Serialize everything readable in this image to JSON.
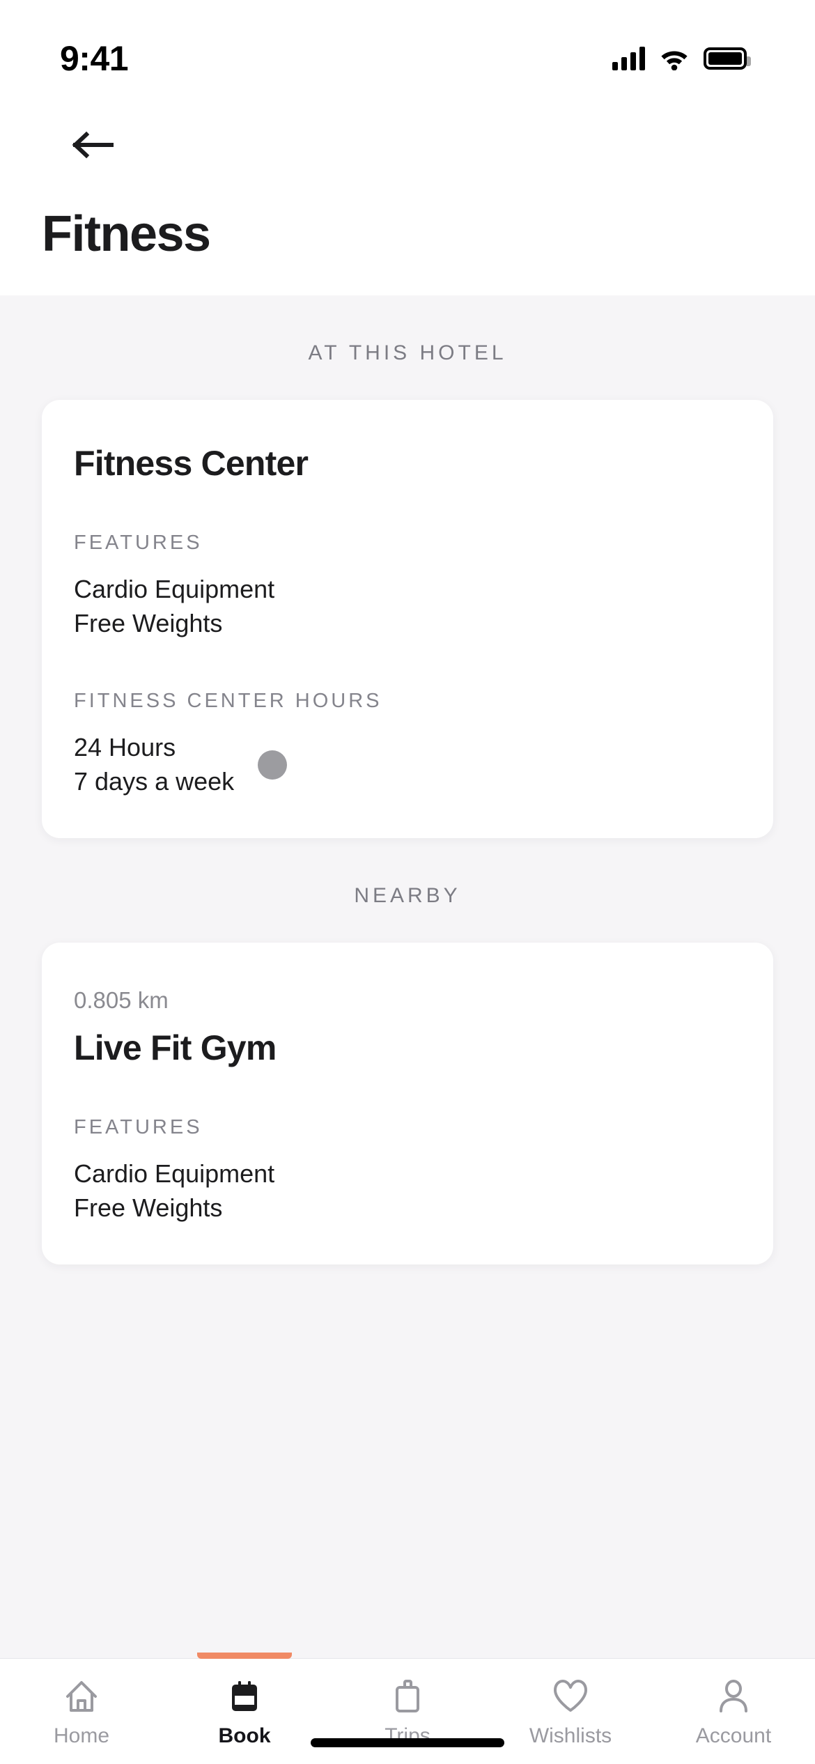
{
  "status_bar": {
    "time": "9:41",
    "signal_icon": "cellular-signal-icon",
    "wifi_icon": "wifi-icon",
    "battery_icon": "battery-full-icon"
  },
  "header": {
    "back_icon": "back-arrow-icon",
    "title": "Fitness"
  },
  "sections": [
    {
      "label": "AT THIS HOTEL",
      "card": {
        "title": "Fitness Center",
        "groups": [
          {
            "label": "FEATURES",
            "items": [
              "Cardio Equipment",
              "Free Weights"
            ]
          },
          {
            "label": "FITNESS CENTER HOURS",
            "items": [
              "24 Hours",
              "7 days a week"
            ],
            "has_dot": true,
            "dot_color": "#9c9ca0"
          }
        ]
      }
    },
    {
      "label": "NEARBY",
      "card": {
        "distance": "0.805 km",
        "title": "Live Fit Gym",
        "groups": [
          {
            "label": "FEATURES",
            "items": [
              "Cardio Equipment",
              "Free Weights"
            ]
          }
        ]
      }
    }
  ],
  "tabbar": {
    "active_index": 1,
    "indicator_color": "#f08a65",
    "items": [
      {
        "label": "Home",
        "icon": "home-icon"
      },
      {
        "label": "Book",
        "icon": "calendar-book-icon"
      },
      {
        "label": "Trips",
        "icon": "suitcase-icon"
      },
      {
        "label": "Wishlists",
        "icon": "heart-icon"
      },
      {
        "label": "Account",
        "icon": "person-icon"
      }
    ]
  },
  "home_indicator": "home-indicator-bar"
}
